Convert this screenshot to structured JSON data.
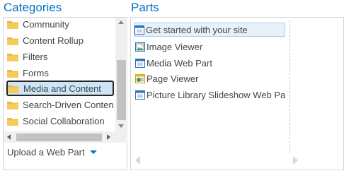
{
  "categories": {
    "heading": "Categories",
    "items": [
      {
        "label": "Community",
        "icon": "folder-icon"
      },
      {
        "label": "Content Rollup",
        "icon": "folder-icon"
      },
      {
        "label": "Filters",
        "icon": "folder-icon"
      },
      {
        "label": "Forms",
        "icon": "folder-icon"
      },
      {
        "label": "Media and Content",
        "icon": "folder-icon",
        "selected": true
      },
      {
        "label": "Search-Driven Content",
        "icon": "folder-icon"
      },
      {
        "label": "Social Collaboration",
        "icon": "folder-icon"
      }
    ],
    "upload_label": "Upload a Web Part"
  },
  "parts": {
    "heading": "Parts",
    "items": [
      {
        "label": "Get started with your site",
        "icon": "webpart-icon",
        "selected": true
      },
      {
        "label": "Image Viewer",
        "icon": "image-viewer-icon"
      },
      {
        "label": "Media Web Part",
        "icon": "webpart-icon"
      },
      {
        "label": "Page Viewer",
        "icon": "page-viewer-icon"
      },
      {
        "label": "Picture Library Slideshow Web Part",
        "icon": "webpart-icon"
      }
    ]
  },
  "colors": {
    "accent": "#0072c6",
    "folder": "#e8b83c",
    "selection_fill": "#cde6f7"
  }
}
